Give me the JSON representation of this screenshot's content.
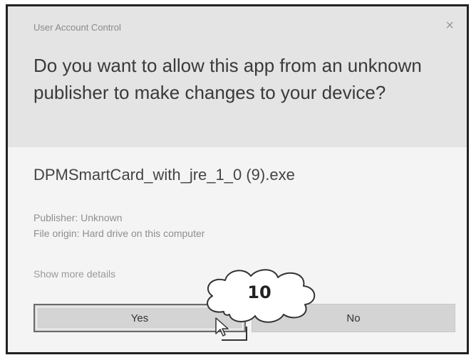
{
  "dialog": {
    "title": "User Account Control",
    "close_glyph": "×",
    "question": "Do you want to allow this app from an unknown publisher to make changes to your device?",
    "app_name": "DPMSmartCard_with_jre_1_0 (9).exe",
    "publisher": "Publisher: Unknown",
    "file_origin": "File origin: Hard drive on this computer",
    "show_more": "Show more details",
    "yes_label": "Yes",
    "no_label": "No"
  },
  "callout": {
    "number": "10"
  },
  "icons": {
    "close": "close-icon",
    "cursor": "mouse-pointer-icon",
    "callout": "cloud-callout"
  }
}
